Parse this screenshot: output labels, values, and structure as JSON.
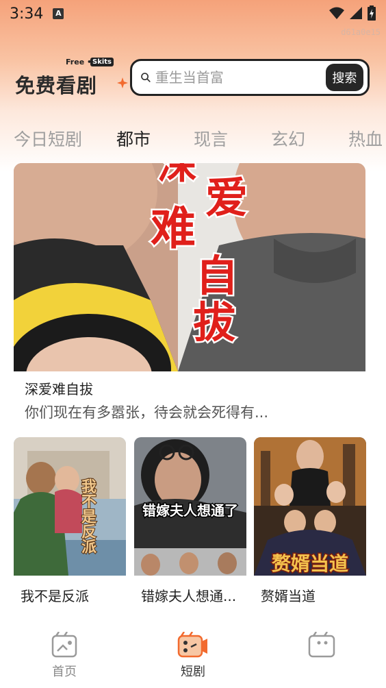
{
  "status_bar": {
    "time": "3:34",
    "notification_badge": "A"
  },
  "device_id": "d61a0e15",
  "logo": {
    "free_label": "Free •",
    "skits_label": "Skits",
    "main_text": "免费看剧"
  },
  "search": {
    "placeholder": "重生当首富",
    "button_label": "搜索"
  },
  "tabs": [
    {
      "label": "今日短剧",
      "active": false
    },
    {
      "label": "都市",
      "active": true
    },
    {
      "label": "现言",
      "active": false
    },
    {
      "label": "玄幻",
      "active": false
    },
    {
      "label": "热血",
      "active": false
    }
  ],
  "featured": {
    "poster_text": [
      "深",
      "爱",
      "难",
      "自",
      "拔"
    ],
    "title": "深爱难自拔",
    "description": "你们现在有多嚣张，待会就会死得有..."
  },
  "cards": [
    {
      "title": "我不是反派",
      "poster_text": "我不是反派"
    },
    {
      "title": "错嫁夫人想通...",
      "poster_text": "错嫁夫人想通了"
    },
    {
      "title": "赘婿当道",
      "poster_text": "赘婿当道"
    }
  ],
  "bottom_nav": [
    {
      "label": "首页",
      "icon": "home-icon",
      "active": false
    },
    {
      "label": "短剧",
      "icon": "drama-icon",
      "active": true
    },
    {
      "label": "",
      "icon": "profile-icon",
      "active": false
    }
  ],
  "colors": {
    "accent": "#f26a2e",
    "header_gradient_top": "#f5a27a",
    "text_dark": "#222222"
  }
}
